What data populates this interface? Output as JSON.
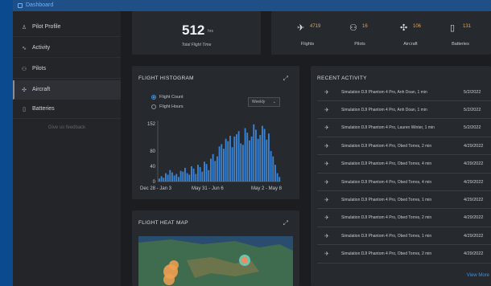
{
  "breadcrumb": "Dashboard",
  "sidebar": {
    "items": [
      {
        "icon": "user-icon",
        "glyph": "♙",
        "label": "Pilot Profile"
      },
      {
        "icon": "activity-icon",
        "glyph": "∿",
        "label": "Activity"
      },
      {
        "icon": "pilots-icon",
        "glyph": "⚇",
        "label": "Pilots"
      },
      {
        "icon": "aircraft-icon",
        "glyph": "✣",
        "label": "Aircraft"
      },
      {
        "icon": "battery-icon",
        "glyph": "▯",
        "label": "Batteries"
      }
    ],
    "active": "Aircraft",
    "feedback": "Give us feedback"
  },
  "flight_time": {
    "value": "512",
    "unit": "hrs",
    "label": "Total Flight Time"
  },
  "stats": [
    {
      "icon": "flight-icon",
      "glyph": "✈",
      "value": "4719",
      "label": "Flights"
    },
    {
      "icon": "pilots-icon",
      "glyph": "⚇",
      "value": "16",
      "label": "Pilots"
    },
    {
      "icon": "drone-icon",
      "glyph": "✣",
      "value": "106",
      "label": "Aircraft"
    },
    {
      "icon": "battery-icon",
      "glyph": "▯",
      "value": "131",
      "label": "Batteries"
    }
  ],
  "histogram": {
    "title": "FLIGHT HISTOGRAM",
    "options": [
      "Flight Count",
      "Flight Hours"
    ],
    "selected_option": "Flight Count",
    "period": "Weekly"
  },
  "chart_data": {
    "type": "bar",
    "title": "FLIGHT HISTOGRAM",
    "y_ticks": [
      "152",
      "80",
      "40",
      "0"
    ],
    "x_labels": [
      "Dec 28 - Jan 3",
      "May 31 - Jun 6",
      "May 2 - May 8"
    ],
    "ylim": [
      0,
      160
    ],
    "values": [
      8,
      14,
      10,
      22,
      18,
      30,
      24,
      16,
      20,
      12,
      28,
      26,
      36,
      22,
      18,
      40,
      34,
      20,
      44,
      38,
      26,
      52,
      46,
      30,
      60,
      72,
      54,
      66,
      92,
      98,
      86,
      112,
      106,
      120,
      90,
      118,
      124,
      132,
      100,
      96,
      140,
      128,
      108,
      118,
      150,
      136,
      112,
      122,
      146,
      138,
      110,
      126,
      80,
      66,
      44,
      22,
      12
    ]
  },
  "heatmap": {
    "title": "FLIGHT HEAT MAP"
  },
  "recent": {
    "title": "RECENT ACTIVITY",
    "rows": [
      {
        "desc": "Simulation DJI Phantom 4 Pro, Anh Doan, 1 min",
        "date": "5/2/2022"
      },
      {
        "desc": "Simulation DJI Phantom 4 Pro, Anh Doan, 1 min",
        "date": "5/2/2022"
      },
      {
        "desc": "Simulation DJI Phantom 4 Pro, Lauren Winter, 1 min",
        "date": "5/2/2022"
      },
      {
        "desc": "Simulation DJI Phantom 4 Pro, Obed Torres, 2 min",
        "date": "4/29/2022"
      },
      {
        "desc": "Simulation DJI Phantom 4 Pro, Obed Torres, 4 min",
        "date": "4/29/2022"
      },
      {
        "desc": "Simulation DJI Phantom 4 Pro, Obed Torres, 4 min",
        "date": "4/29/2022"
      },
      {
        "desc": "Simulation DJI Phantom 4 Pro, Obed Torres, 1 min",
        "date": "4/29/2022"
      },
      {
        "desc": "Simulation DJI Phantom 4 Pro, Obed Torres, 2 min",
        "date": "4/29/2022"
      },
      {
        "desc": "Simulation DJI Phantom 4 Pro, Obed Torres, 1 min",
        "date": "4/29/2022"
      },
      {
        "desc": "Simulation DJI Phantom 4 Pro, Obed Torres, 2 min",
        "date": "4/29/2022"
      }
    ],
    "view_more": "View More"
  },
  "colors": {
    "accent": "#3d8fe0",
    "stat_value": "#e7a24a",
    "bar": "#3a84d6"
  }
}
